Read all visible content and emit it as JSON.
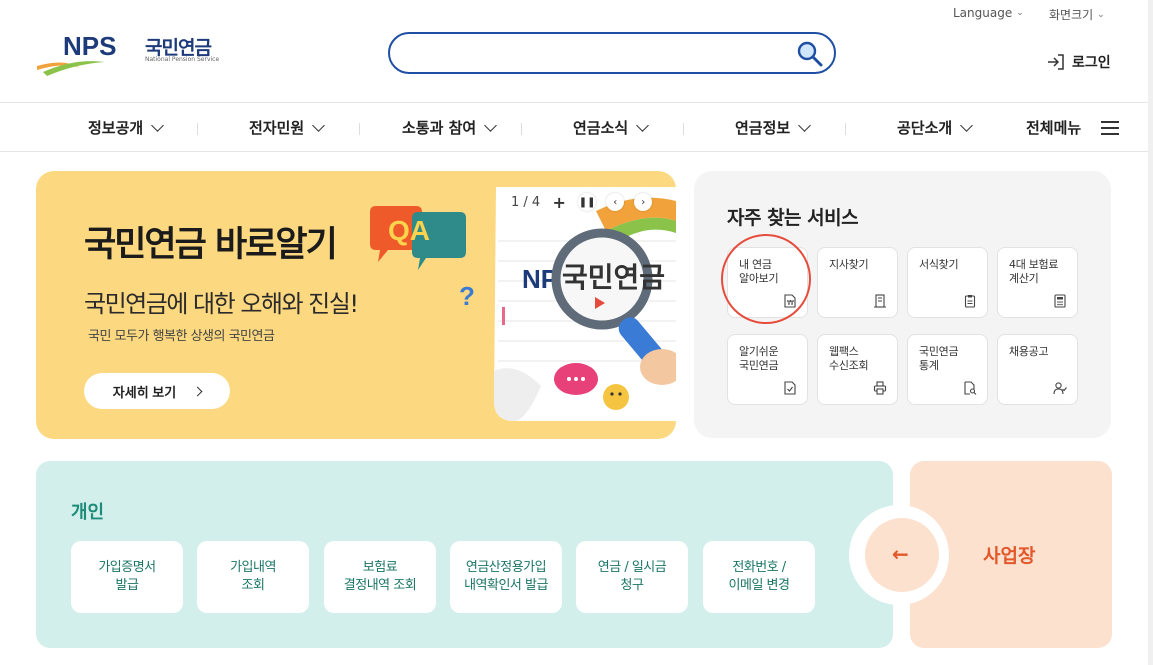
{
  "header": {
    "language_label": "Language",
    "font_size_label": "화면크기",
    "logo_abbr": "NPS",
    "logo_korean": "국민연금",
    "logo_english": "National Pension Service",
    "search_placeholder": "",
    "login_label": "로그인"
  },
  "nav": {
    "items": [
      {
        "label": "정보공개"
      },
      {
        "label": "전자민원"
      },
      {
        "label": "소통과 참여"
      },
      {
        "label": "연금소식"
      },
      {
        "label": "연금정보"
      },
      {
        "label": "공단소개"
      }
    ],
    "all_menu_label": "전체메뉴"
  },
  "banner": {
    "title": "국민연금 바로알기",
    "qa_badge": "QA",
    "subtitle": "국민연금에 대한 오해와 진실!",
    "description": "국민 모두가 행복한 상생의 국민연금",
    "detail_button": "자세히 보기",
    "pager_text": "1 / 4",
    "art_logo_text": "NPS",
    "art_magnified_text": "국민연금",
    "colors": {
      "background": "#fcd981"
    }
  },
  "services": {
    "title": "자주 찾는 서비스",
    "items": [
      {
        "label": "내 연금\n알아보기",
        "icon": "won-document-icon"
      },
      {
        "label": "지사찾기",
        "icon": "building-icon"
      },
      {
        "label": "서식찾기",
        "icon": "clipboard-icon"
      },
      {
        "label": "4대 보험료\n계산기",
        "icon": "calculator-icon"
      },
      {
        "label": "알기쉬운\n국민연금",
        "icon": "document-check-icon"
      },
      {
        "label": "웹팩스\n수신조회",
        "icon": "printer-icon"
      },
      {
        "label": "국민연금\n통계",
        "icon": "document-search-icon"
      },
      {
        "label": "채용공고",
        "icon": "user-check-icon"
      }
    ]
  },
  "personal": {
    "title": "개인",
    "buttons": [
      {
        "label": "가입증명서\n발급"
      },
      {
        "label": "가입내역\n조회"
      },
      {
        "label": "보험료\n결정내역 조회"
      },
      {
        "label": "연금산정용가입\n내역확인서 발급"
      },
      {
        "label": "연금 / 일시금\n청구"
      },
      {
        "label": "전화번호 /\n이메일 변경"
      }
    ],
    "colors": {
      "background": "#d3efec",
      "text": "#1a7565"
    }
  },
  "business": {
    "label": "사업장",
    "arrow": "←",
    "colors": {
      "background": "#fde1cf",
      "text": "#e2582a"
    }
  }
}
